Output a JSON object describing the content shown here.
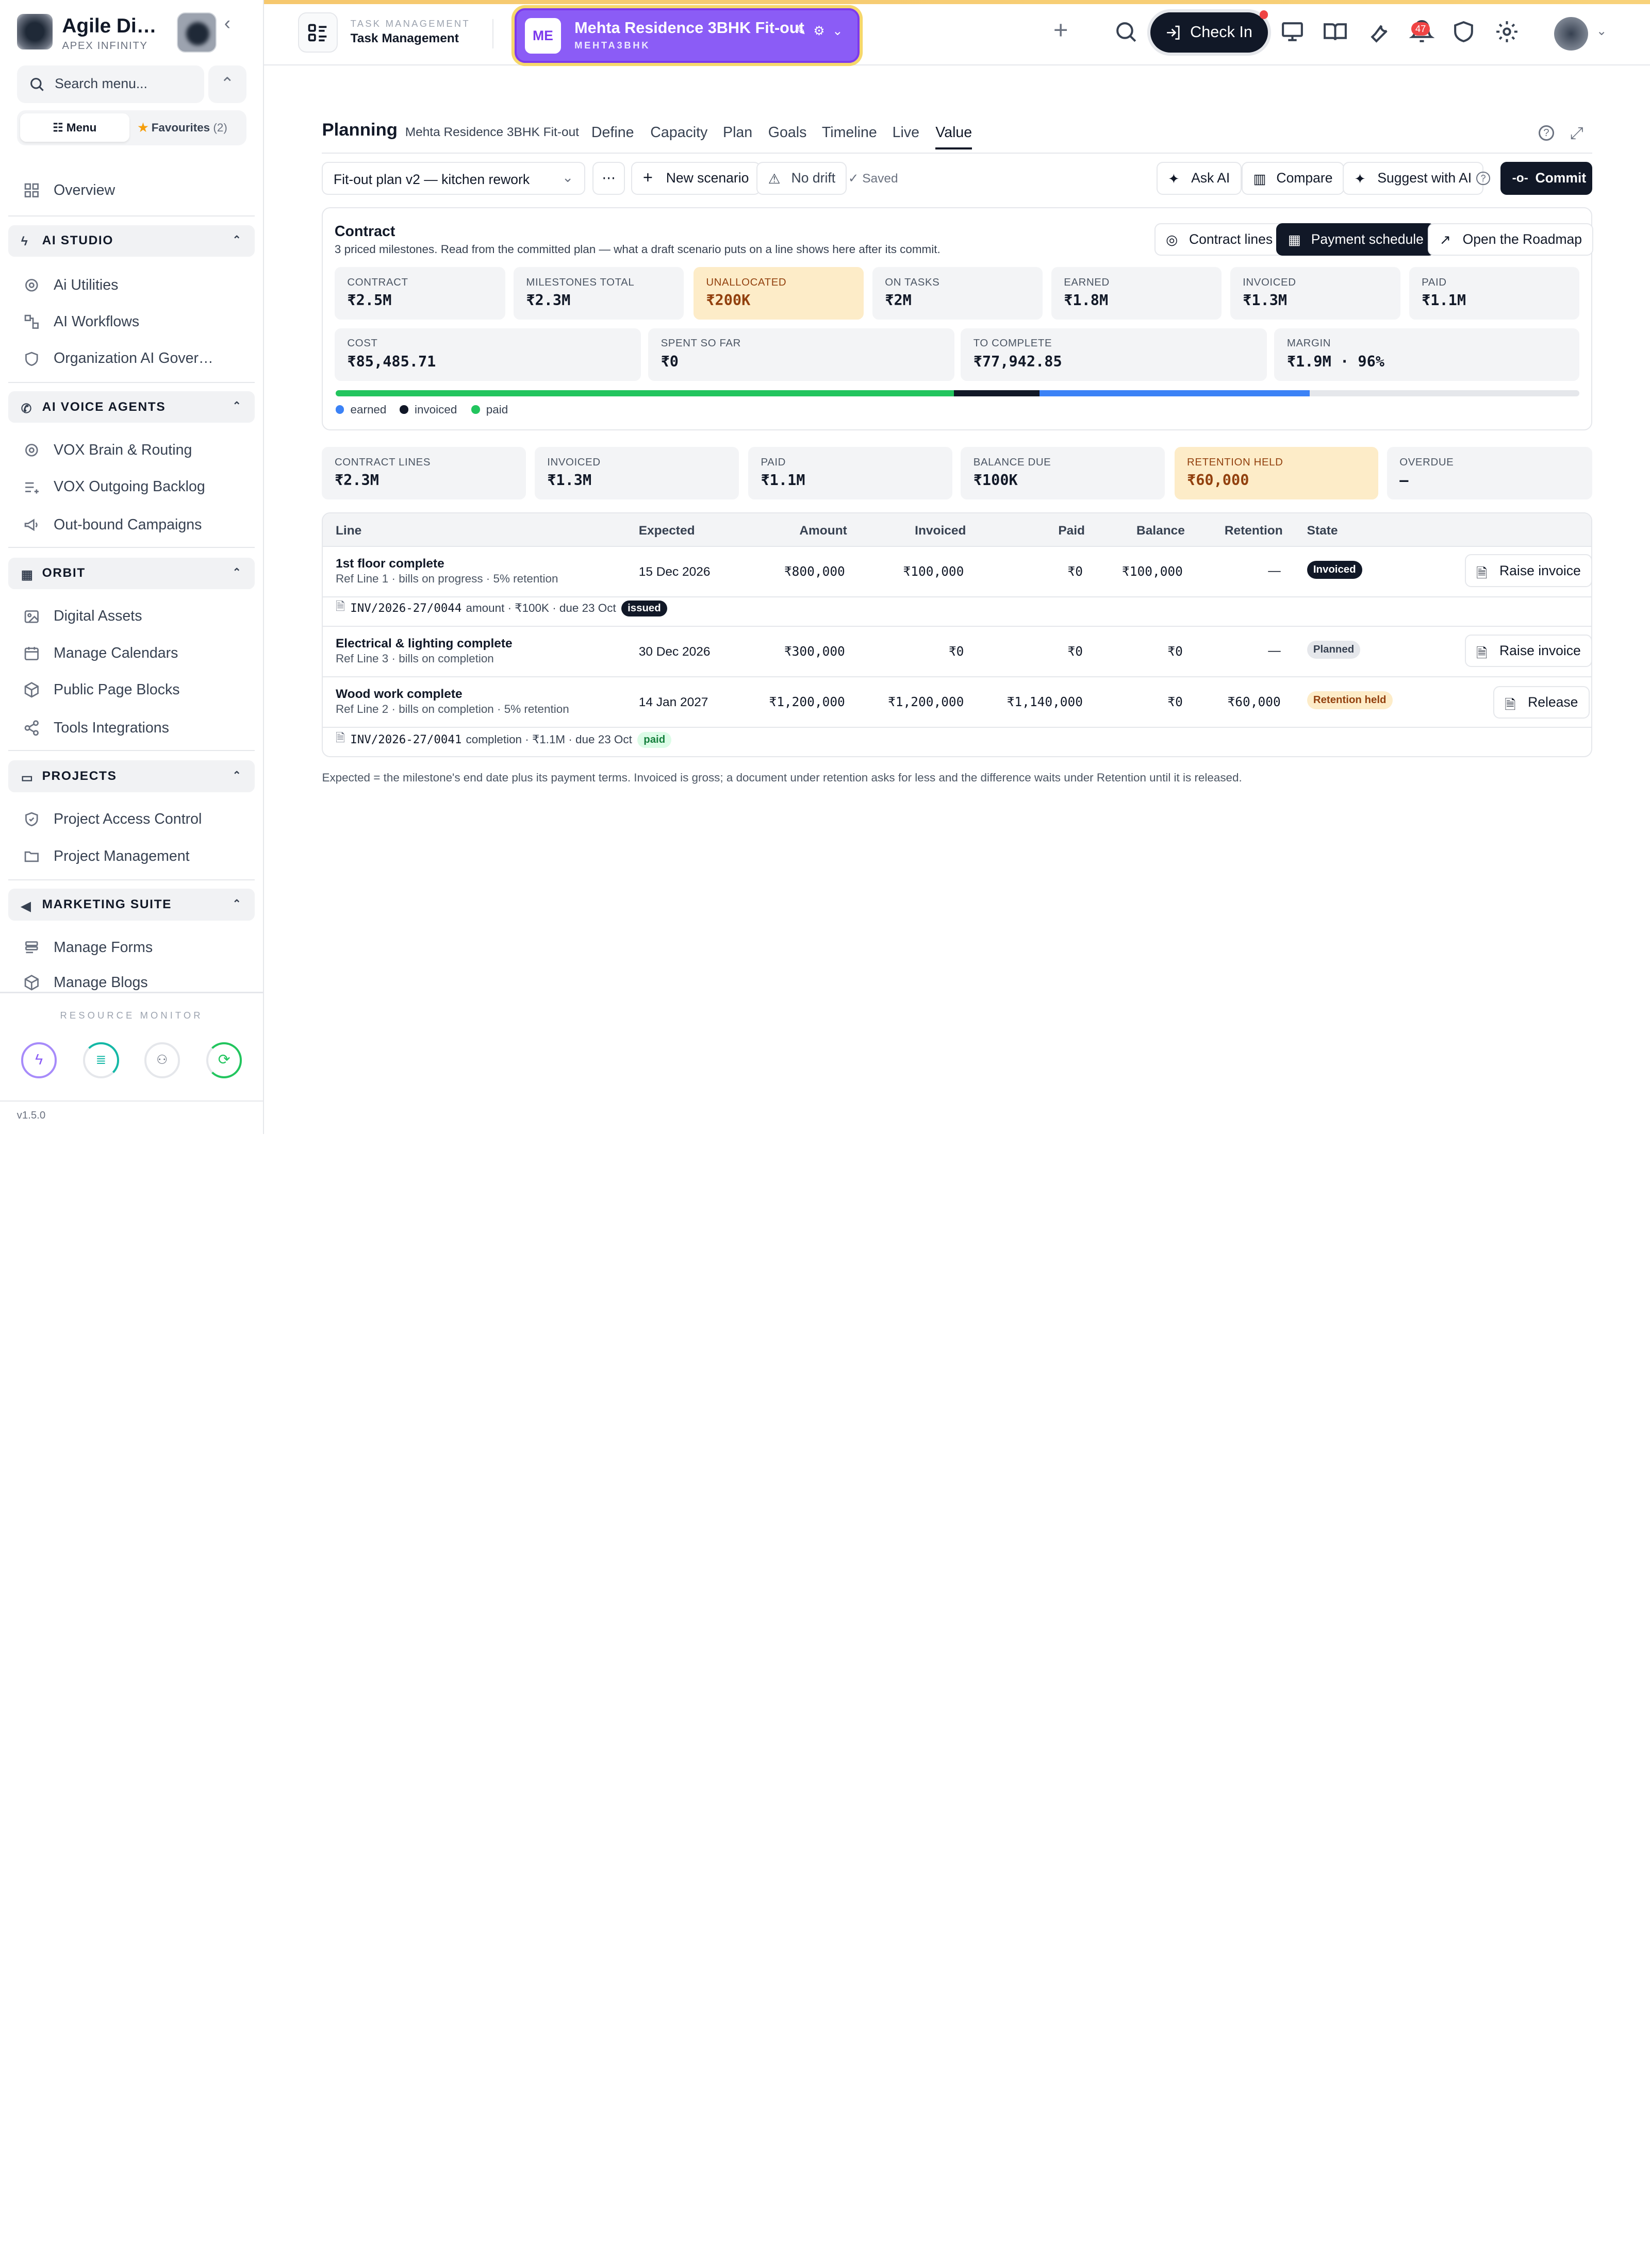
{
  "sidebar": {
    "brand_title": "Agile Di…",
    "brand_sub": "APEX INFINITY",
    "search_placeholder": "Search menu...",
    "menu_tab": "Menu",
    "fav_tab": "Favourites",
    "fav_count": "(2)",
    "overview": "Overview",
    "sections": [
      {
        "title": "AI STUDIO",
        "items": [
          "Ai Utilities",
          "AI Workflows",
          "Organization AI Gover…"
        ]
      },
      {
        "title": "AI VOICE AGENTS",
        "items": [
          "VOX Brain & Routing",
          "VOX Outgoing Backlog",
          "Out-bound Campaigns"
        ]
      },
      {
        "title": "ORBIT",
        "items": [
          "Digital Assets",
          "Manage Calendars",
          "Public Page Blocks",
          "Tools Integrations"
        ]
      },
      {
        "title": "PROJECTS",
        "items": [
          "Project Access Control",
          "Project Management"
        ]
      },
      {
        "title": "MARKETING SUITE",
        "items": [
          "Manage Forms",
          "Manage Blogs"
        ]
      }
    ],
    "resource_monitor": "RESOURCE MONITOR",
    "version": "v1.5.0"
  },
  "header": {
    "module_sub": "TASK MANAGEMENT",
    "module_title": "Task Management",
    "project_initials": "ME",
    "project_name": "Mehta Residence 3BHK Fit-out",
    "project_code": "MEHTA3BHK",
    "checkin": "Check In",
    "notif_count": "47"
  },
  "planning": {
    "title": "Planning",
    "project": "Mehta Residence 3BHK Fit-out",
    "tabs": [
      "Define",
      "Capacity",
      "Plan",
      "Goals",
      "Timeline",
      "Live",
      "Value"
    ],
    "active_tab": "Value",
    "scenario": "Fit-out plan v2 — kitchen rework",
    "new_scenario": "New scenario",
    "no_drift": "No drift",
    "saved": "Saved",
    "ask_ai": "Ask AI",
    "compare": "Compare",
    "suggest": "Suggest with AI",
    "commit": "Commit"
  },
  "contract": {
    "title": "Contract",
    "desc": "3 priced milestones. Read from the committed plan — what a draft scenario puts on a line shows here after its commit.",
    "btn_lines": "Contract lines",
    "btn_schedule": "Payment schedule",
    "btn_roadmap": "Open the Roadmap",
    "stats1": [
      {
        "label": "CONTRACT",
        "value": "₹2.5M"
      },
      {
        "label": "MILESTONES TOTAL",
        "value": "₹2.3M"
      },
      {
        "label": "UNALLOCATED",
        "value": "₹200K"
      },
      {
        "label": "ON TASKS",
        "value": "₹2M"
      },
      {
        "label": "EARNED",
        "value": "₹1.8M"
      },
      {
        "label": "INVOICED",
        "value": "₹1.3M"
      },
      {
        "label": "PAID",
        "value": "₹1.1M"
      }
    ],
    "stats2": [
      {
        "label": "COST",
        "value": "₹85,485.71"
      },
      {
        "label": "SPENT SO FAR",
        "value": "₹0"
      },
      {
        "label": "TO COMPLETE",
        "value": "₹77,942.85"
      },
      {
        "label": "MARGIN",
        "value": "₹1.9M · 96%"
      }
    ],
    "legend": [
      "earned",
      "invoiced",
      "paid"
    ],
    "progress": {
      "paid_fraction": 0.497,
      "invoiced_fraction": 0.566,
      "earned_fraction": 0.783
    },
    "colors": {
      "earned": "#3b82f6",
      "invoiced": "#111827",
      "paid": "#22c55e"
    }
  },
  "summary": [
    {
      "label": "CONTRACT LINES",
      "value": "₹2.3M"
    },
    {
      "label": "INVOICED",
      "value": "₹1.3M"
    },
    {
      "label": "PAID",
      "value": "₹1.1M"
    },
    {
      "label": "BALANCE DUE",
      "value": "₹100K"
    },
    {
      "label": "RETENTION HELD",
      "value": "₹60,000"
    },
    {
      "label": "OVERDUE",
      "value": "—"
    }
  ],
  "table": {
    "headers": [
      "Line",
      "Expected",
      "Amount",
      "Invoiced",
      "Paid",
      "Balance",
      "Retention",
      "State"
    ],
    "rows": [
      {
        "title": "1st floor complete",
        "sub": "Ref Line 1 · bills on progress · 5% retention",
        "expected": "15 Dec 2026",
        "amount": "₹800,000",
        "invoiced": "₹100,000",
        "paid": "₹0",
        "balance": "₹100,000",
        "retention": "—",
        "state": "Invoiced",
        "action": "Raise invoice",
        "doc": {
          "id": "INV/2026-27/0044",
          "text": "amount · ₹100K · due 23 Oct",
          "status": "issued"
        }
      },
      {
        "title": "Electrical & lighting complete",
        "sub": "Ref Line 3 · bills on completion",
        "expected": "30 Dec 2026",
        "amount": "₹300,000",
        "invoiced": "₹0",
        "paid": "₹0",
        "balance": "₹0",
        "retention": "—",
        "state": "Planned",
        "action": "Raise invoice"
      },
      {
        "title": "Wood work complete",
        "sub": "Ref Line 2 · bills on completion · 5% retention",
        "expected": "14 Jan 2027",
        "amount": "₹1,200,000",
        "invoiced": "₹1,200,000",
        "paid": "₹1,140,000",
        "balance": "₹0",
        "retention": "₹60,000",
        "state": "Retention held",
        "action": "Release",
        "doc": {
          "id": "INV/2026-27/0041",
          "text": "completion · ₹1.1M · due 23 Oct",
          "status": "paid"
        }
      }
    ]
  },
  "footnote": "Expected = the milestone's end date plus its payment terms. Invoiced is gross; a document under retention asks for less and the difference waits under Retention until it is released."
}
